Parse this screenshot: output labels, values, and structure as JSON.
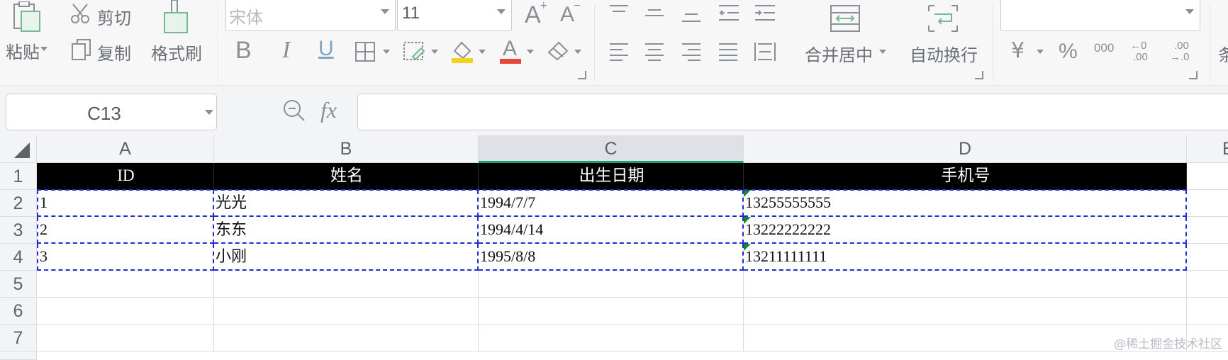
{
  "ribbon": {
    "clipboard": {
      "paste_label": "粘贴",
      "cut_label": "剪切",
      "copy_label": "复制",
      "format_painter_label": "格式刷"
    },
    "font": {
      "font_name_placeholder": "宋体",
      "font_size_value": "11",
      "increase_size_glyph": "A",
      "decrease_size_glyph": "A",
      "bold_glyph": "B",
      "italic_glyph": "I",
      "underline_glyph": "U",
      "font_color_glyph": "A"
    },
    "alignment": {
      "merge_center_label": "合并居中",
      "wrap_text_label": "自动换行"
    },
    "number": {
      "currency_glyph": "¥",
      "percent_glyph": "%",
      "thousands_glyph": "000",
      "increase_decimal_top": "←0",
      "increase_decimal_bottom": ".00",
      "decrease_decimal_top": ".00",
      "decrease_decimal_bottom": "→.0",
      "partial_next_glyph": "条"
    }
  },
  "formula_bar": {
    "name_box_value": "C13",
    "fx_label": "fx",
    "formula_value": ""
  },
  "sheet": {
    "corner": "",
    "columns": [
      "A",
      "B",
      "C",
      "D",
      "E"
    ],
    "selected_column": "C",
    "rows": [
      "1",
      "2",
      "3",
      "4",
      "5",
      "6",
      "7"
    ],
    "header_row": [
      "ID",
      "姓名",
      "出生日期",
      "手机号"
    ],
    "data_rows": [
      [
        "1",
        "光光",
        "1994/7/7",
        "13255555555"
      ],
      [
        "2",
        "东东",
        "1994/4/14",
        "13222222222"
      ],
      [
        "3",
        "小刚",
        "1995/8/8",
        "13211111111"
      ]
    ]
  },
  "colors": {
    "header_fill": "#000000",
    "header_text": "#ffffff",
    "selection_border": "#1f2fd0",
    "selected_column_accent": "#1e9e6a",
    "error_indicator": "#0a8a2a",
    "font_color_bar": "#e8453c",
    "fill_color_bar": "#f2d21b"
  },
  "watermark": "@稀土掘金技术社区"
}
